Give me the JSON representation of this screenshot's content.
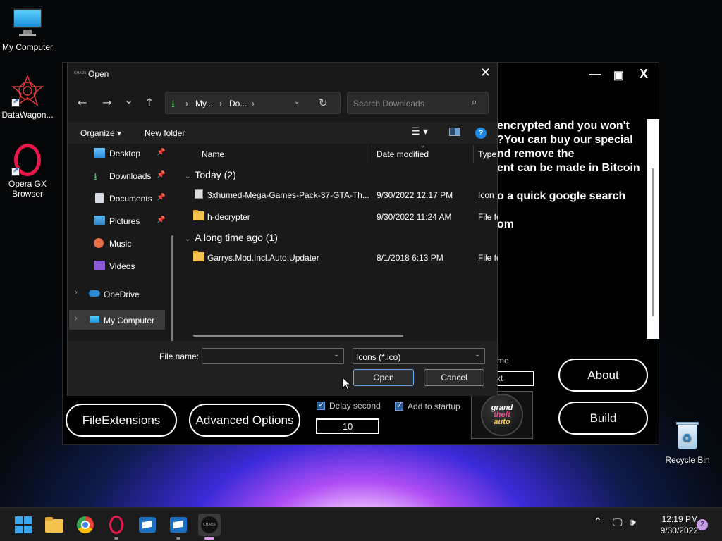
{
  "desktop": {
    "icons": [
      {
        "label": "My Computer",
        "icon": "computer-icon"
      },
      {
        "label": "DataWagon...",
        "icon": "datawagon-icon"
      },
      {
        "label": "Opera GX Browser",
        "icon": "opera-gx-icon"
      },
      {
        "label": "Recycle Bin",
        "icon": "recycle-bin-icon"
      }
    ]
  },
  "builder": {
    "message_lines": [
      "encrypted and you won't",
      "?You can buy our special",
      "nd remove the",
      "ent can be made in Bitcoin",
      "",
      "o a quick google search",
      "",
      "om"
    ],
    "window_controls": {
      "minimize": "—",
      "maximize": "▣",
      "close": "X"
    },
    "partial_label": "me",
    "partial_input": "xt",
    "buttons": {
      "file_extensions": "FileExtensions",
      "advanced_options": "Advanced Options",
      "about": "About",
      "build": "Build"
    },
    "delay_second": {
      "label": "Delay second",
      "checked": true,
      "value": "10"
    },
    "add_to_startup": {
      "label": "Add to startup",
      "checked": true
    },
    "icon_preview_text": "grand theft auto"
  },
  "dialog": {
    "title": "Open",
    "title_icon_text": "CHAOS",
    "nav": {
      "back": "←",
      "forward": "→",
      "recent": "⌄",
      "up": "↑",
      "refresh": "↻"
    },
    "address": {
      "crumbs": [
        "My...",
        "Do..."
      ]
    },
    "search": {
      "placeholder": "Search Downloads"
    },
    "commands": {
      "organize": "Organize ▾",
      "new_folder": "New folder"
    },
    "help": "?",
    "nav_items": [
      {
        "label": "Desktop",
        "icon": "desktop-icon",
        "pinned": true
      },
      {
        "label": "Downloads",
        "icon": "downloads-icon",
        "pinned": true
      },
      {
        "label": "Documents",
        "icon": "documents-icon",
        "pinned": true
      },
      {
        "label": "Pictures",
        "icon": "pictures-icon",
        "pinned": true
      },
      {
        "label": "Music",
        "icon": "music-icon",
        "pinned": false
      },
      {
        "label": "Videos",
        "icon": "videos-icon",
        "pinned": false
      },
      {
        "label": "OneDrive",
        "icon": "onedrive-icon",
        "pinned": false
      },
      {
        "label": "My Computer",
        "icon": "computer-icon",
        "pinned": false
      }
    ],
    "columns": {
      "name": "Name",
      "date": "Date modified",
      "type": "Type"
    },
    "groups": [
      {
        "label": "Today (2)",
        "files": [
          {
            "name": "3xhumed-Mega-Games-Pack-37-GTA-Th...",
            "date": "9/30/2022 12:17 PM",
            "type": "Icon",
            "icon": "ico-file-icon"
          },
          {
            "name": "h-decrypter",
            "date": "9/30/2022 11:24 AM",
            "type": "File fo",
            "icon": "folder-icon"
          }
        ]
      },
      {
        "label": "A long time ago (1)",
        "files": [
          {
            "name": "Garrys.Mod.Incl.Auto.Updater",
            "date": "8/1/2018 6:13 PM",
            "type": "File fo",
            "icon": "folder-icon"
          }
        ]
      }
    ],
    "file_name_label": "File name:",
    "file_name_value": "",
    "file_type": "Icons (*.ico)",
    "open_button": "Open",
    "cancel_button": "Cancel"
  },
  "taskbar": {
    "apps": [
      "start-icon",
      "file-explorer-icon",
      "chrome-icon",
      "opera-gx-icon",
      "app-box-icon",
      "app-box-icon",
      "chaos-app-icon"
    ],
    "time": "12:19 PM",
    "date": "9/30/2022",
    "notifications": "2"
  }
}
